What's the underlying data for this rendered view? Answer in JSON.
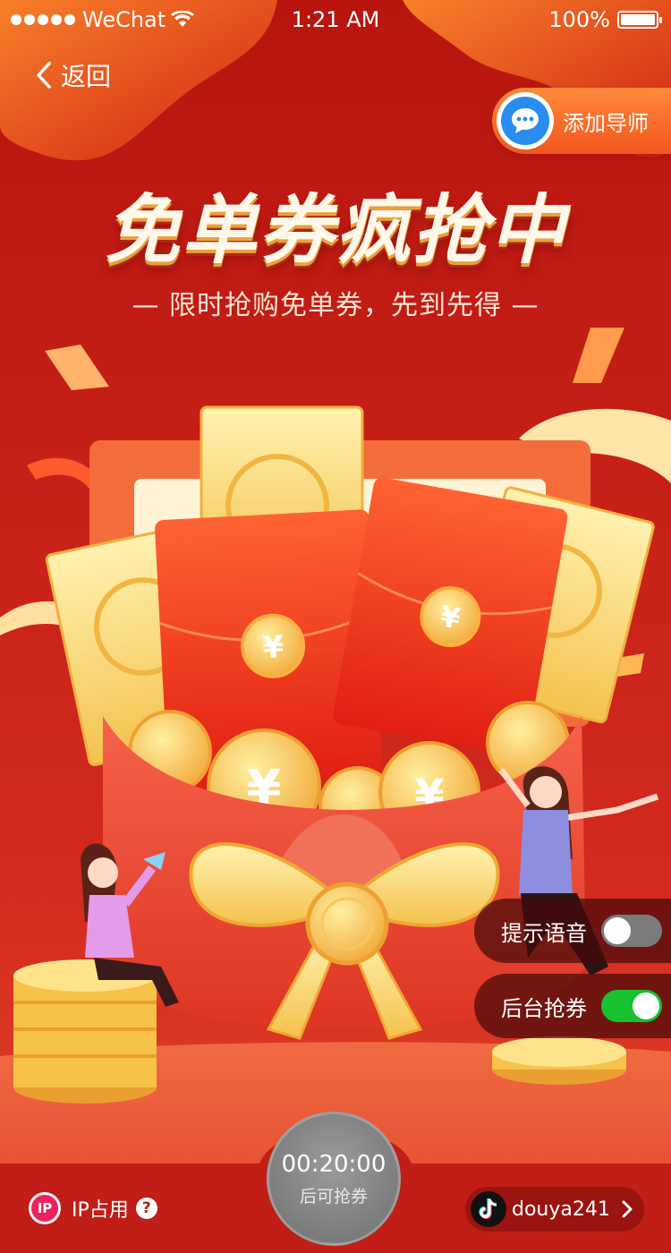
{
  "status_bar": {
    "carrier": "WeChat",
    "time": "1:21 AM",
    "battery": "100%"
  },
  "nav": {
    "back_label": "返回"
  },
  "tutor_button": {
    "label": "添加导师"
  },
  "hero": {
    "title": "免单券疯抢中",
    "subtitle": "— 限时抢购免单券，先到先得 —"
  },
  "toggles": [
    {
      "label": "提示语音",
      "on": false
    },
    {
      "label": "后台抢券",
      "on": true
    }
  ],
  "bottom": {
    "ip_badge": "IP",
    "ip_label": "IP占用",
    "help": "?",
    "countdown_time": "00:20:00",
    "countdown_hint": "后可抢券",
    "account_name": "douya241"
  },
  "colors": {
    "background": "#c8201c",
    "accent_orange": "#f2561d",
    "switch_on": "#19c02f",
    "switch_off": "#7b7b7b"
  },
  "icons": [
    "wifi-icon",
    "battery-icon",
    "chevron-left-icon",
    "chat-bubble-icon",
    "tiktok-icon",
    "question-icon",
    "chevron-right-icon"
  ]
}
